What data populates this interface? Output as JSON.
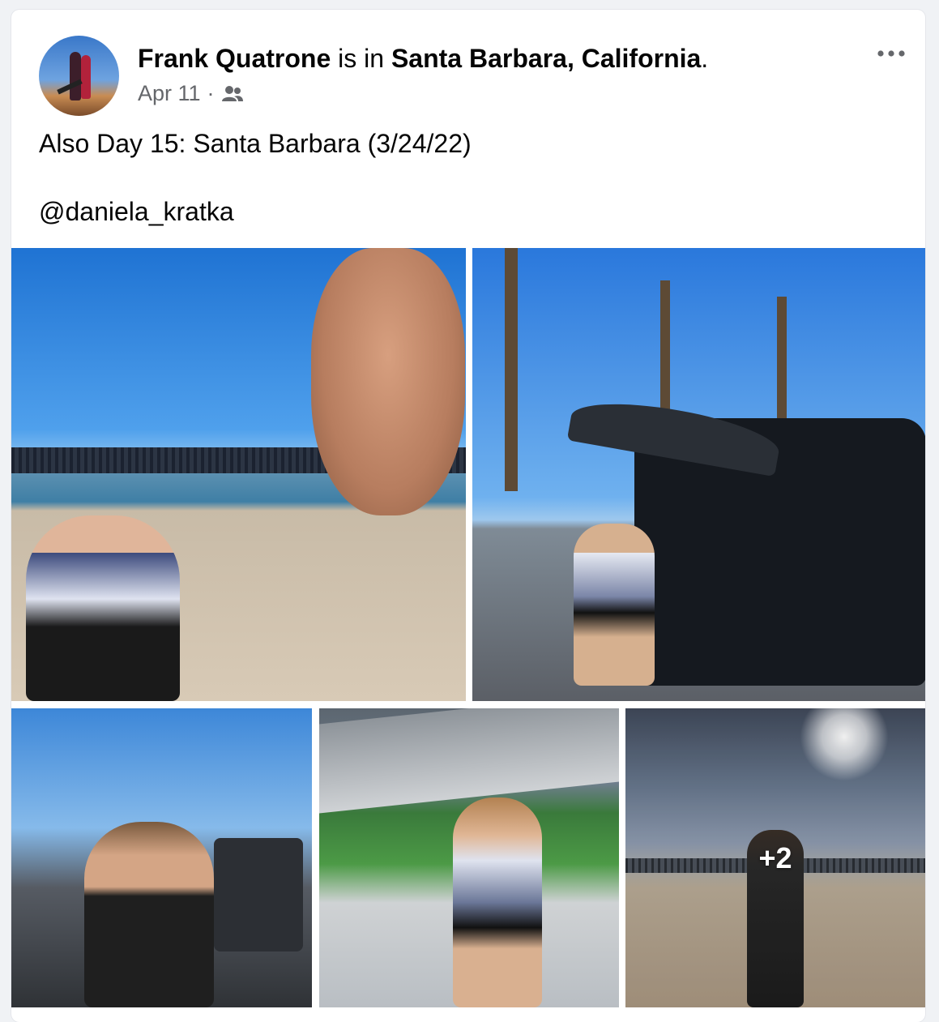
{
  "post": {
    "author_name": "Frank Quatrone",
    "connector": " is in ",
    "location": "Santa Barbara, California",
    "end_punct": ".",
    "date": "Apr 11",
    "separator": "·",
    "audience_icon": "friends-icon",
    "more_icon": "more-options-icon",
    "text_line1": "Also Day 15: Santa Barbara (3/24/22)",
    "mention": "@daniela_kratka"
  },
  "photos": {
    "extra_count": "+2"
  },
  "colors": {
    "meta_gray": "#65676b",
    "text_dark": "#050505",
    "card_bg": "#ffffff"
  }
}
